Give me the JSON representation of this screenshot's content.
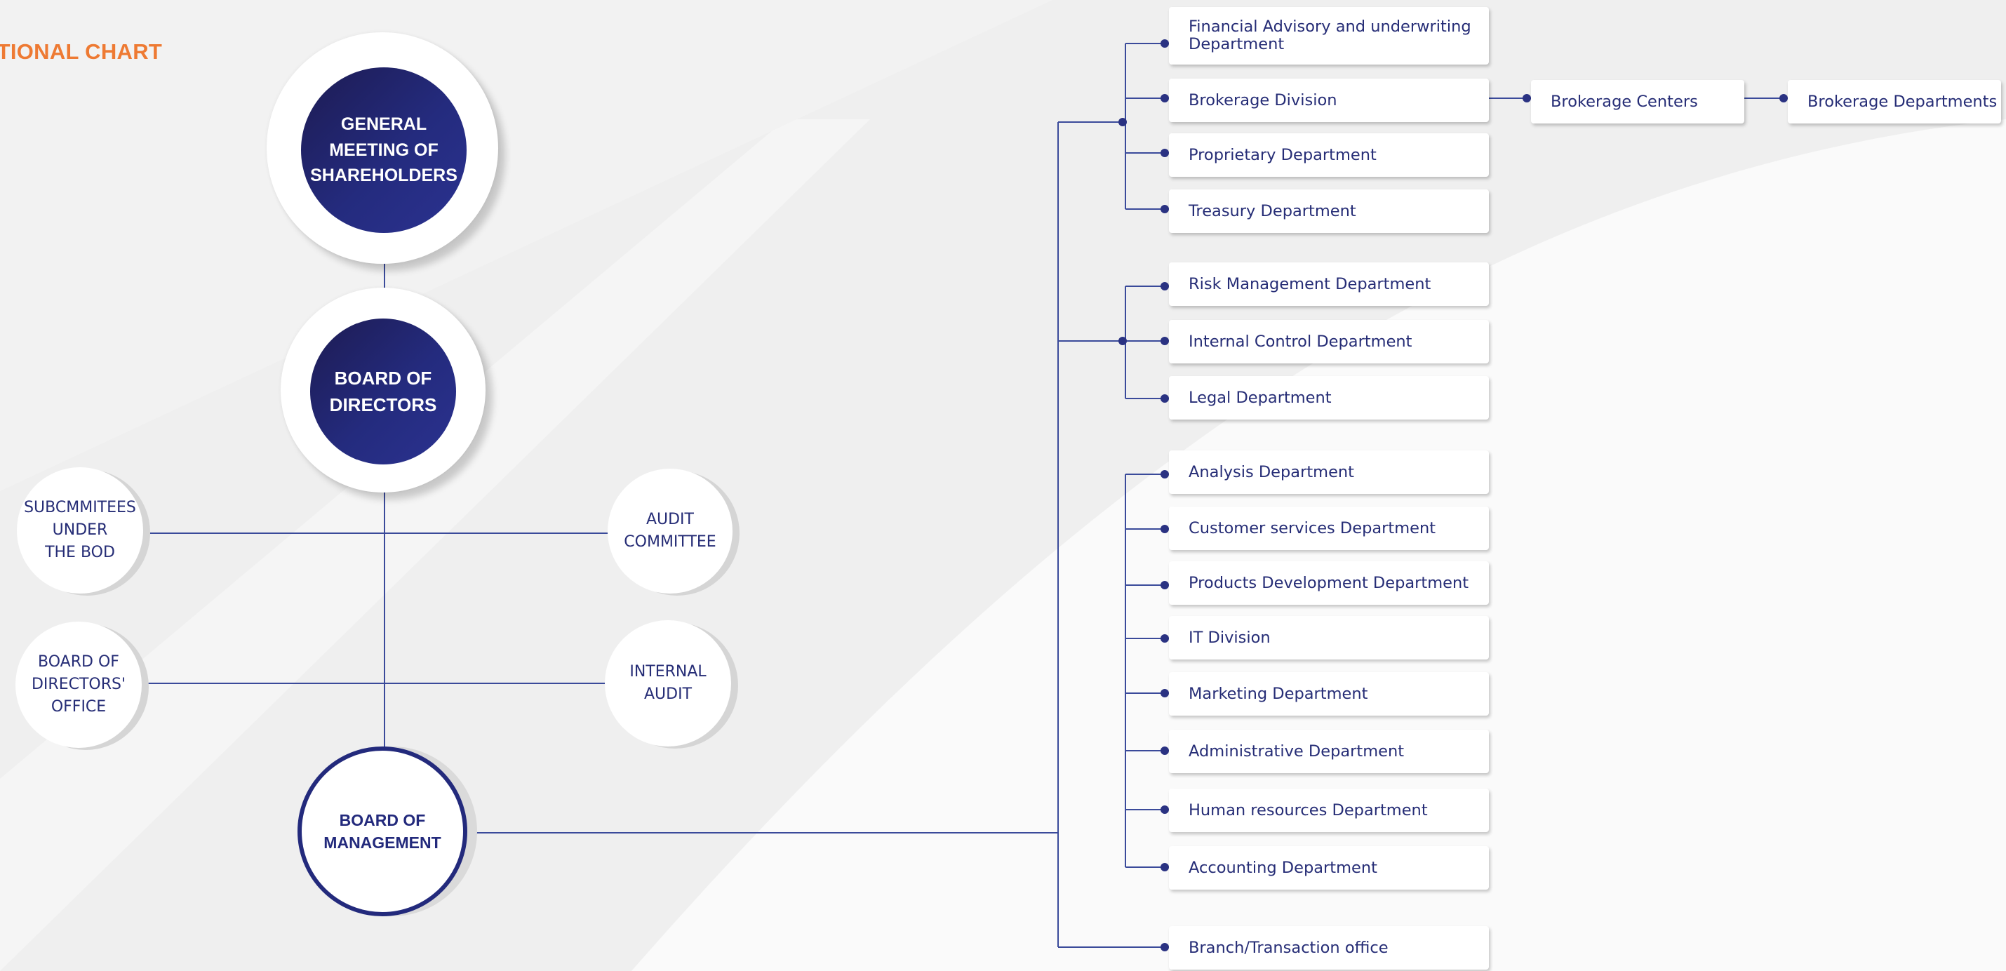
{
  "chart_title": "ZATIONAL CHART",
  "colors": {
    "accent": "#ee7a33",
    "navy": "#232a7c",
    "line": "#3a4a9a",
    "text": "#262d76"
  },
  "top_nodes": {
    "gms": "GENERAL\nMEETING OF\nSHAREHOLDERS",
    "bod": "BOARD OF\nDIRECTORS",
    "bom": "BOARD OF\nMANAGEMENT"
  },
  "side_nodes": {
    "subcommittees": "SUBCMMITEES\nUNDER\nTHE BOD",
    "audit_committee": "AUDIT\nCOMMITTEE",
    "bod_office": "BOARD OF\nDIRECTORS'\nOFFICE",
    "internal_audit": "INTERNAL\nAUDIT"
  },
  "groups": [
    {
      "departments": [
        "Financial Advisory and underwriting Department",
        "Brokerage Division",
        "Proprietary Department",
        "Treasury Department"
      ]
    },
    {
      "departments": [
        "Risk Management Department",
        "Internal Control Department",
        "Legal Department"
      ]
    },
    {
      "departments": [
        "Analysis Department",
        "Customer services Department",
        "Products Development Department",
        "IT Division",
        "Marketing Department",
        "Administrative Department",
        "Human resources Department",
        "Accounting Department"
      ]
    }
  ],
  "branch_office": "Branch/Transaction office",
  "brokerage_chain": [
    "Brokerage Centers",
    "Brokerage Departments"
  ]
}
